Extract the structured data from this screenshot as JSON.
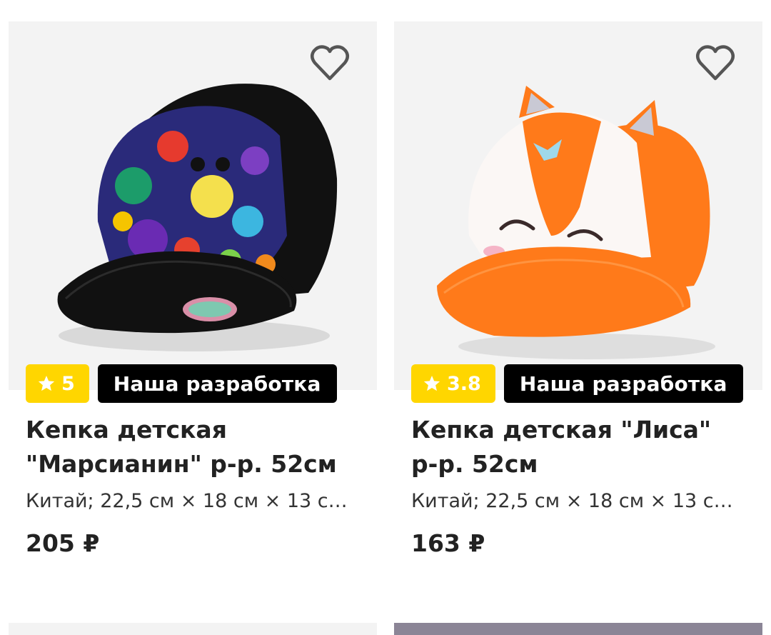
{
  "products": [
    {
      "rating": "5",
      "badge": "Наша разработка",
      "title": "Кепка детская \"Марсианин\" р-р. 52см",
      "specs": "Китай; 22,5 см × 18 см × 13 см;...",
      "price": "205 ₽"
    },
    {
      "rating": "3.8",
      "badge": "Наша разработка",
      "title": "Кепка детская \"Лиса\" р-р. 52см",
      "specs": "Китай; 22,5 см × 18 см × 13 см;...",
      "price": "163 ₽"
    }
  ],
  "colors": {
    "rating_bg": "#ffd600",
    "badge_bg": "#000000",
    "image_bg": "#f3f3f3"
  },
  "icons": {
    "favorite": "heart-outline-icon",
    "rating": "star-icon"
  }
}
